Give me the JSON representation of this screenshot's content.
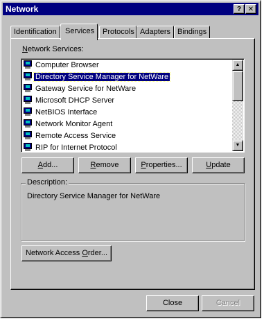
{
  "window": {
    "title": "Network",
    "help_glyph": "?",
    "close_glyph": "✕"
  },
  "tabs": [
    {
      "label": "Identification"
    },
    {
      "label": "Services"
    },
    {
      "label": "Protocols"
    },
    {
      "label": "Adapters"
    },
    {
      "label": "Bindings"
    }
  ],
  "services": {
    "label_mnemonic": "N",
    "label_rest": "etwork Services:",
    "items": [
      {
        "label": "Computer Browser"
      },
      {
        "label": "Directory Service Manager for NetWare"
      },
      {
        "label": "Gateway Service for NetWare"
      },
      {
        "label": "Microsoft DHCP Server"
      },
      {
        "label": "NetBIOS Interface"
      },
      {
        "label": "Network Monitor Agent"
      },
      {
        "label": "Remote Access Service"
      },
      {
        "label": "RIP for Internet Protocol"
      }
    ],
    "selected_index": 1
  },
  "buttons": {
    "add": {
      "m": "A",
      "rest": "dd..."
    },
    "remove": {
      "m": "R",
      "rest": "emove"
    },
    "properties": {
      "m": "P",
      "rest": "roperties..."
    },
    "update": {
      "m": "U",
      "rest": "pdate"
    },
    "access_order": {
      "pre": "Network Access ",
      "m": "O",
      "rest": "rder..."
    }
  },
  "description": {
    "label": "Description:",
    "text": "Directory Service Manager for NetWare"
  },
  "dialog": {
    "close_label": "Close",
    "cancel_label": "Cancel"
  },
  "icons": {
    "service": "network-service-icon",
    "scroll_up": "scroll-up-arrow-icon",
    "scroll_down": "scroll-down-arrow-icon"
  }
}
